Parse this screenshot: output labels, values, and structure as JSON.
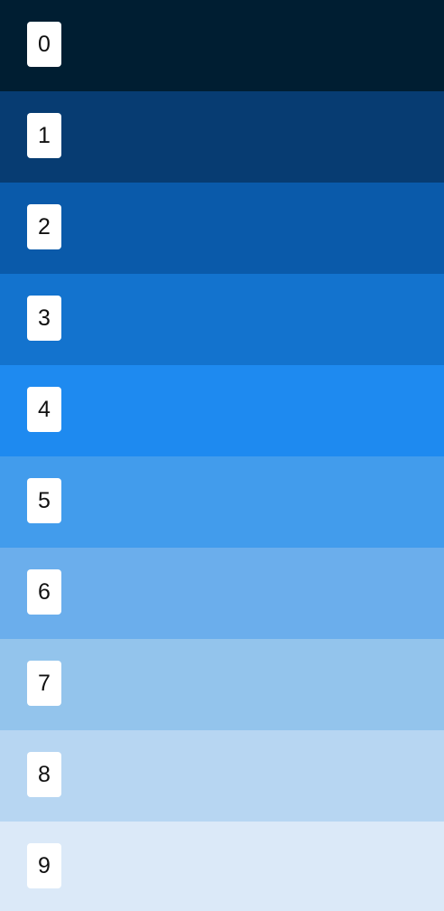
{
  "palette": {
    "swatches": [
      {
        "label": "0",
        "color": "#001E32"
      },
      {
        "label": "1",
        "color": "#073C72"
      },
      {
        "label": "2",
        "color": "#0A5AAA"
      },
      {
        "label": "3",
        "color": "#1373CE"
      },
      {
        "label": "4",
        "color": "#1E8AF0"
      },
      {
        "label": "5",
        "color": "#429CEC"
      },
      {
        "label": "6",
        "color": "#6BAEEC"
      },
      {
        "label": "7",
        "color": "#93C4EC"
      },
      {
        "label": "8",
        "color": "#B7D6F2"
      },
      {
        "label": "9",
        "color": "#DBE9F8"
      }
    ]
  }
}
